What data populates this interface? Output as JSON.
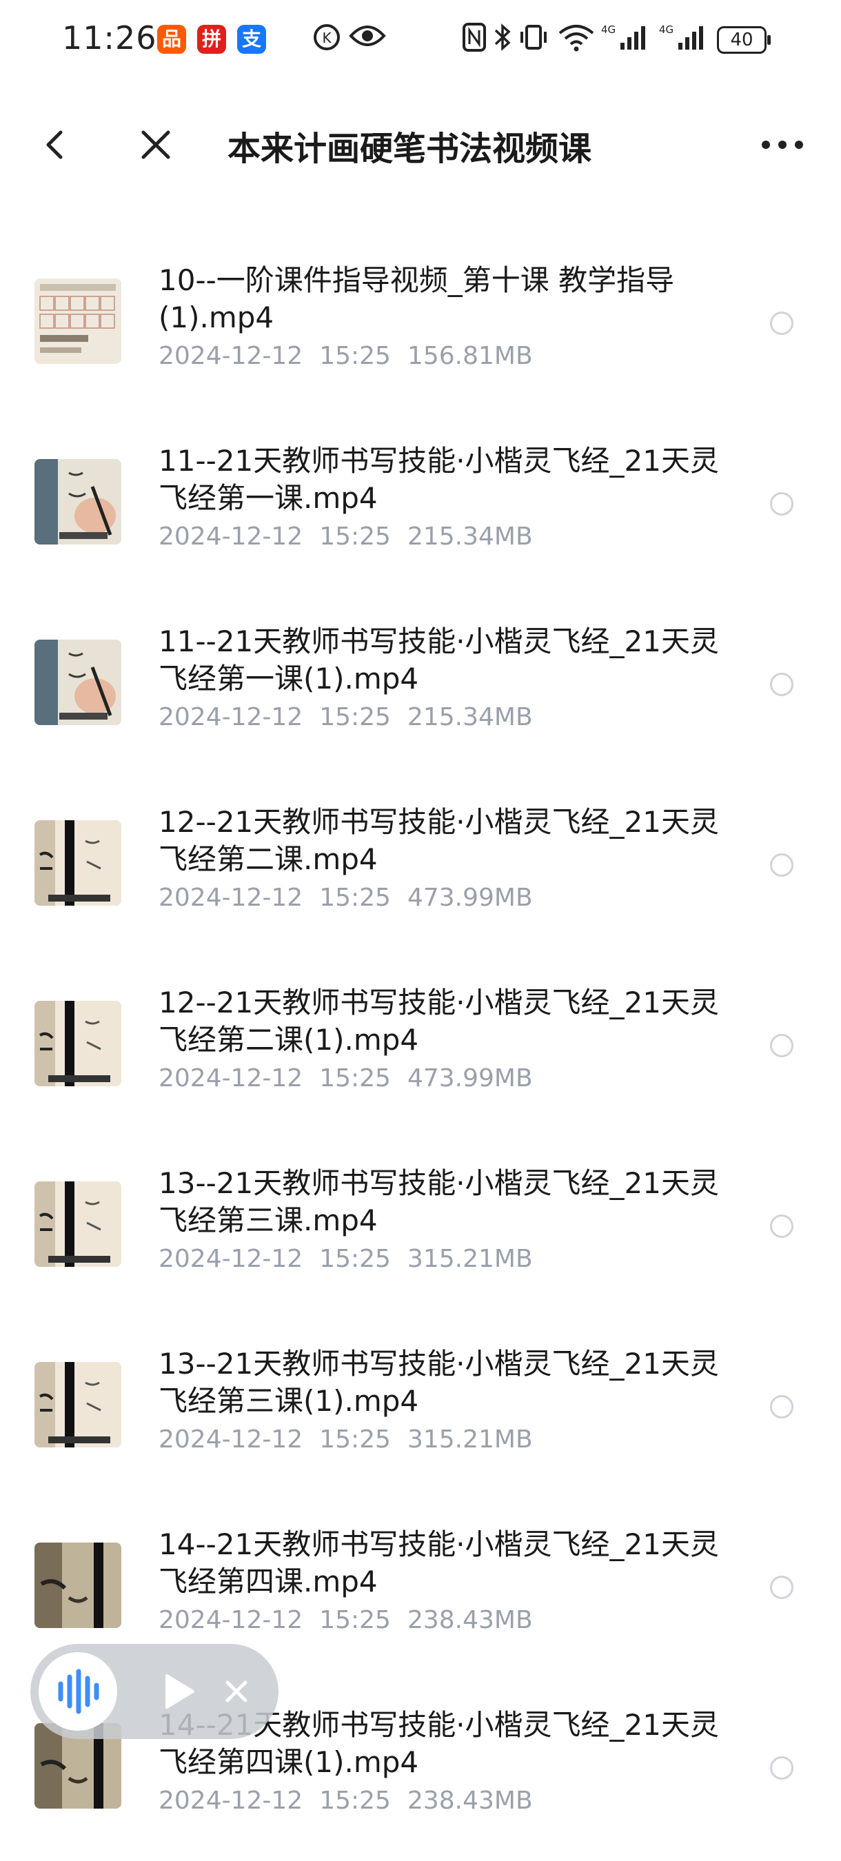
{
  "status_bar": {
    "time": "11:26",
    "app_badges": [
      {
        "icon": "taobao-app-icon",
        "glyph": "品",
        "color": "#ff5a00"
      },
      {
        "icon": "pinduoduo-app-icon",
        "glyph": "拼",
        "color": "#e0201b"
      },
      {
        "icon": "alipay-app-icon",
        "glyph": "支",
        "color": "#1677ff"
      }
    ],
    "battery": "40"
  },
  "header": {
    "title": "本来计画硬笔书法视频课"
  },
  "files": [
    {
      "name": "10--一阶课件指导视频_第十课 教学指导(1).mp4",
      "date": "2024-12-12",
      "time": "15:25",
      "size": "156.81MB",
      "thumb": "sheet"
    },
    {
      "name": "11--21天教师书写技能·小楷灵飞经_21天灵飞经第一课.mp4",
      "date": "2024-12-12",
      "time": "15:25",
      "size": "215.34MB",
      "thumb": "hand"
    },
    {
      "name": "11--21天教师书写技能·小楷灵飞经_21天灵飞经第一课(1).mp4",
      "date": "2024-12-12",
      "time": "15:25",
      "size": "215.34MB",
      "thumb": "hand"
    },
    {
      "name": "12--21天教师书写技能·小楷灵飞经_21天灵飞经第二课.mp4",
      "date": "2024-12-12",
      "time": "15:25",
      "size": "473.99MB",
      "thumb": "scroll"
    },
    {
      "name": "12--21天教师书写技能·小楷灵飞经_21天灵飞经第二课(1).mp4",
      "date": "2024-12-12",
      "time": "15:25",
      "size": "473.99MB",
      "thumb": "scroll"
    },
    {
      "name": "13--21天教师书写技能·小楷灵飞经_21天灵飞经第三课.mp4",
      "date": "2024-12-12",
      "time": "15:25",
      "size": "315.21MB",
      "thumb": "scroll"
    },
    {
      "name": "13--21天教师书写技能·小楷灵飞经_21天灵飞经第三课(1).mp4",
      "date": "2024-12-12",
      "time": "15:25",
      "size": "315.21MB",
      "thumb": "scroll"
    },
    {
      "name": "14--21天教师书写技能·小楷灵飞经_21天灵飞经第四课.mp4",
      "date": "2024-12-12",
      "time": "15:25",
      "size": "238.43MB",
      "thumb": "dark"
    },
    {
      "name": "14--21天教师书写技能·小楷灵飞经_21天灵飞经第四课(1).mp4",
      "date": "2024-12-12",
      "time": "15:25",
      "size": "238.43MB",
      "thumb": "dark"
    }
  ]
}
